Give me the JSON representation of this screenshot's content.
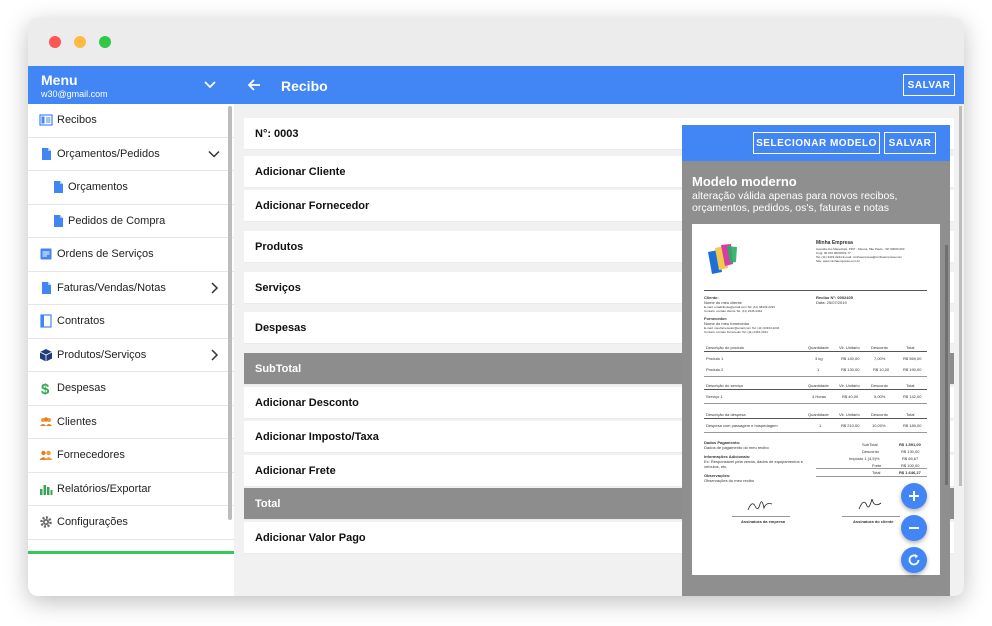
{
  "sidebar": {
    "title": "Menu",
    "email": "w30@gmail.com",
    "items": [
      {
        "label": "Recibos"
      },
      {
        "label": "Orçamentos/Pedidos"
      },
      {
        "label": "Orçamentos"
      },
      {
        "label": "Pedidos de Compra"
      },
      {
        "label": "Ordens de Serviços"
      },
      {
        "label": "Faturas/Vendas/Notas"
      },
      {
        "label": "Contratos"
      },
      {
        "label": "Produtos/Serviços"
      },
      {
        "label": "Despesas"
      },
      {
        "label": "Clientes"
      },
      {
        "label": "Fornecedores"
      },
      {
        "label": "Relatórios/Exportar"
      },
      {
        "label": "Configurações"
      }
    ]
  },
  "topbar": {
    "title": "Recibo",
    "save_label": "SALVAR"
  },
  "form": {
    "number": "N°: 0003",
    "add_client": "Adicionar Cliente",
    "add_supplier": "Adicionar Fornecedor",
    "products": "Produtos",
    "services": "Serviços",
    "expenses": "Despesas",
    "subtotal": "SubTotal",
    "add_discount": "Adicionar Desconto",
    "add_tax": "Adicionar Imposto/Taxa",
    "add_freight": "Adicionar Frete",
    "total": "Total",
    "add_paid": "Adicionar Valor Pago"
  },
  "modal": {
    "select_label": "SELECIONAR MODELO",
    "save_label": "SALVAR",
    "title": "Modelo moderno",
    "subtitle": "alteração válida apenas para novos recibos, orçamentos, pedidos, os's, faturas e notas"
  },
  "preview": {
    "company": "Minha Empresa",
    "company_lines": [
      "Avenida dos Marechais, 1567 - Mooca, São Paulo - SP 00000-000",
      "Cnpj: 00.970.000/0001-77",
      "Tel: (11) 3433-3244 E-mail: minhaempresa@minhaempresa.com",
      "Site: www.minhaempresa.com.br"
    ],
    "client_label": "Cliente:",
    "client_name": "Nome do meu cliente",
    "client_line": "E-mail: emailcliente@email.com Tel: (11) 98433-2234",
    "client_contact": "Contato: contato cliente Tel: (11) 2345-3344",
    "receipt_no": "Recibo N°: 0002405",
    "receipt_date": "Data: 25/07/2019",
    "supplier_label": "Fornecedor:",
    "supplier_name": "Nome do meu fornecedor",
    "supplier_line": "E-mail: meufornecedor@email.com Tel: (11) 93333-2234",
    "supplier_contact": "Contato: contato fornecedor Tel: (11) 4443-3344",
    "prod_headers": [
      "Descrição do produto",
      "Quantidade",
      "Vlr. Unitário",
      "Desconto",
      "Total"
    ],
    "prod_rows": [
      [
        "Produto 1",
        "3 kg",
        "R$ 140,00",
        "7,00%",
        "R$ 569,00"
      ],
      [
        "Produto 2",
        "1",
        "R$ 130,00",
        "R$ 10,00",
        "R$ 190,00"
      ]
    ],
    "serv_headers": [
      "Descrição do serviço",
      "Quantidade",
      "Vlr. Unitário",
      "Desconto",
      "Total"
    ],
    "serv_rows": [
      [
        "Serviço 1",
        "4 Horas",
        "R$ 40,00",
        "5,00%",
        "R$ 142,00"
      ]
    ],
    "exp_headers": [
      "Descrição da despesa",
      "Quantidade",
      "Vlr. Unitário",
      "Desconto",
      "Total"
    ],
    "exp_rows": [
      [
        "Despesa com passagem e hospedagem",
        "1",
        "R$ 210,00",
        "10,00%",
        "R$ 189,00"
      ]
    ],
    "payment_label": "Dados Pagamento:",
    "payment_text": "Dados de pagamento do meu recibo",
    "info_label": "Informações Adicionais:",
    "info_text": "Ex: Responsável pela venda, dados de equipamentos e veículos, etc.",
    "obs_label": "Observações:",
    "obs_text": "Observações do meu recibo",
    "totals": [
      [
        "SubTotal",
        "R$ 1.591,00"
      ],
      [
        "Desconto",
        "R$ 130,00"
      ],
      [
        "Imposto 1 (4,5)%",
        "R$ 65,67"
      ],
      [
        "Frete",
        "R$ 100,00"
      ],
      [
        "Total",
        "R$ 1.646,27"
      ]
    ],
    "sign_company": "Assinatura da empresa",
    "sign_client": "Assinatura do cliente"
  },
  "colors": {
    "primary": "#4285f4",
    "section": "#8d8d8d",
    "accent_green": "#34c759"
  }
}
